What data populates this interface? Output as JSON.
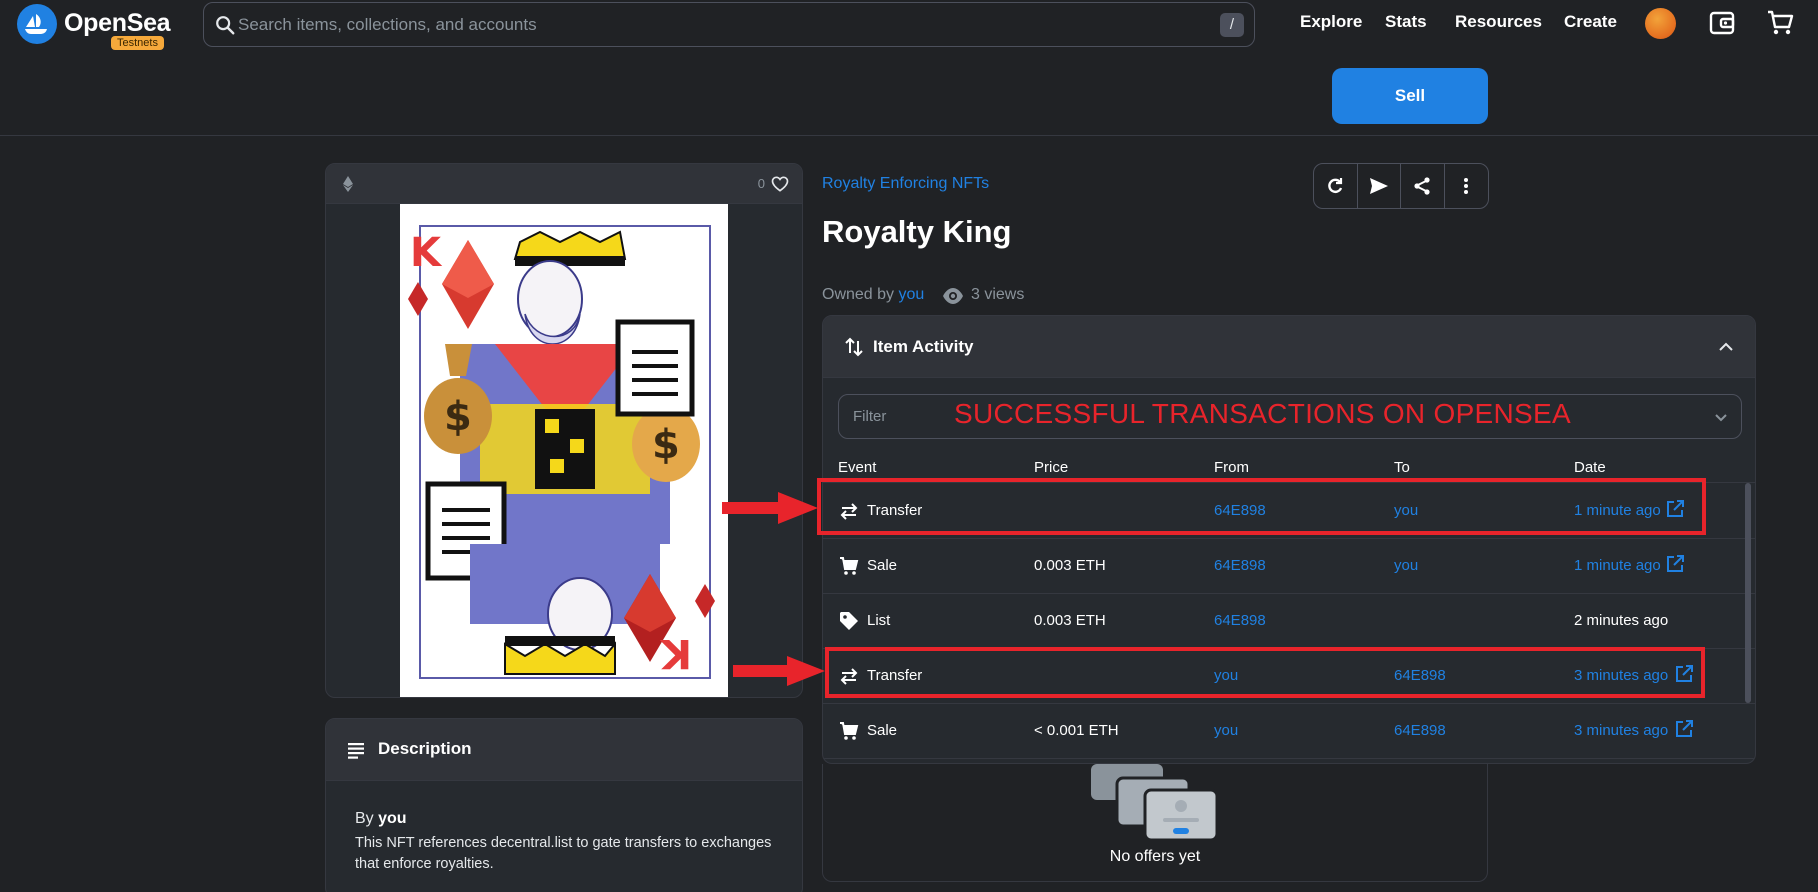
{
  "nav": {
    "brand": "OpenSea",
    "badge": "Testnets",
    "search_placeholder": "Search items, collections, and accounts",
    "search_shortcut": "/",
    "links": [
      "Explore",
      "Stats",
      "Resources",
      "Create"
    ]
  },
  "sell_button": "Sell",
  "item": {
    "favorites": "0",
    "collection": "Royalty Enforcing NFTs",
    "title": "Royalty King",
    "owned_by_label": "Owned by",
    "owner": "you",
    "views": "3 views"
  },
  "description": {
    "header": "Description",
    "by_label": "By",
    "by_value": "you",
    "text": "This NFT references decentral.list to gate transfers to exchanges that enforce royalties."
  },
  "activity": {
    "header": "Item Activity",
    "filter_placeholder": "Filter",
    "columns": [
      "Event",
      "Price",
      "From",
      "To",
      "Date"
    ],
    "rows": [
      {
        "event": "Transfer",
        "icon": "transfer-icon",
        "price": "",
        "from": "64E898",
        "to": "you",
        "date": "1 minute ago",
        "link": true
      },
      {
        "event": "Sale",
        "icon": "cart-icon",
        "price": "0.003 ETH",
        "from": "64E898",
        "to": "you",
        "date": "1 minute ago",
        "link": true
      },
      {
        "event": "List",
        "icon": "tag-icon",
        "price": "0.003 ETH",
        "from": "64E898",
        "to": "",
        "date": "2 minutes ago",
        "link": false
      },
      {
        "event": "Transfer",
        "icon": "transfer-icon",
        "price": "",
        "from": "you",
        "to": "64E898",
        "date": "3 minutes ago",
        "link": true
      },
      {
        "event": "Sale",
        "icon": "cart-icon",
        "price": "< 0.001 ETH",
        "from": "you",
        "to": "64E898",
        "date": "3 minutes ago",
        "link": true
      }
    ]
  },
  "offers": {
    "empty_text": "No offers yet"
  },
  "annotation": {
    "caption": "SUCCESSFUL TRANSACTIONS ON OPENSEA",
    "color": "#e8242b"
  },
  "colors": {
    "background": "#202225",
    "accent": "#2081e2",
    "badge": "#f6a93b"
  }
}
